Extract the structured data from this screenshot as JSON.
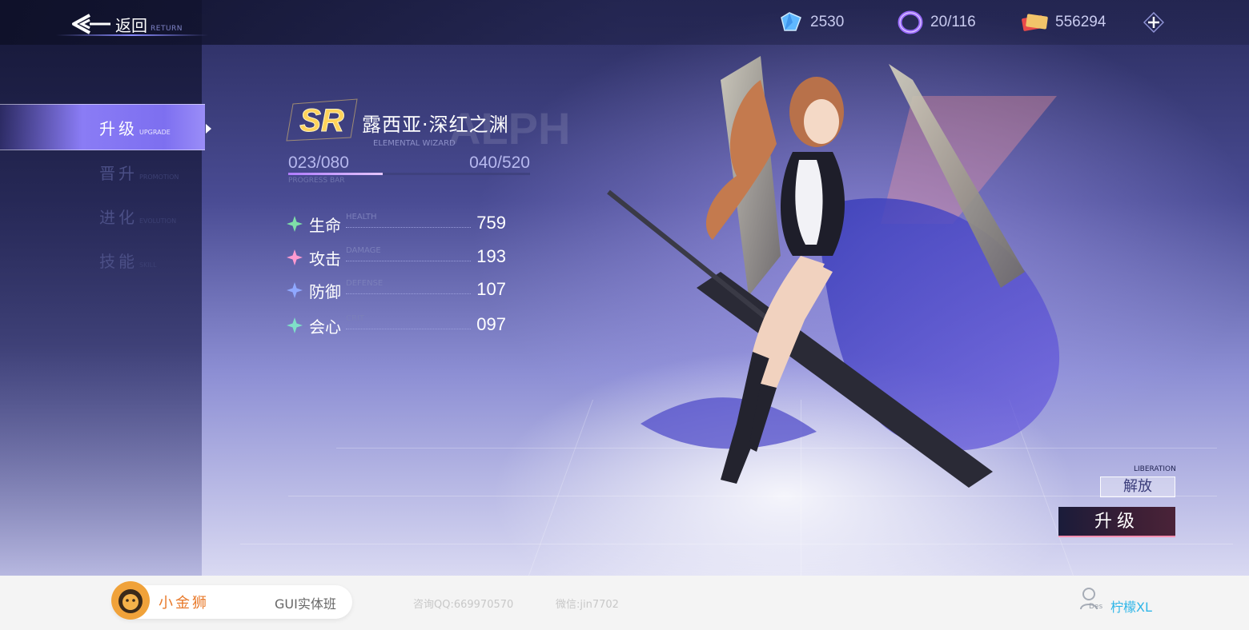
{
  "header": {
    "back_label": "返回",
    "back_sub": "RETURN",
    "currencies": [
      {
        "icon": "crystal-icon",
        "value": "2530"
      },
      {
        "icon": "ring-icon",
        "value": "20/116"
      },
      {
        "icon": "ticket-icon",
        "value": "556294"
      }
    ],
    "plus_icon": "plus-icon"
  },
  "nav": {
    "items": [
      {
        "label": "升级",
        "sub": "UPGRADE",
        "active": true
      },
      {
        "label": "晋升",
        "sub": "PROMOTION",
        "active": false
      },
      {
        "label": "进化",
        "sub": "EVOLUTION",
        "active": false
      },
      {
        "label": "技能",
        "sub": "SKILL",
        "active": false
      }
    ]
  },
  "character": {
    "rarity": "SR",
    "name": "露西亚·深红之渊",
    "class": "ELEMENTAL WIZARD",
    "bg_word": "ALPH",
    "level_current": "023/080",
    "exp": "040/520",
    "progress_caption": "PROGRESS BAR",
    "progress_fraction": 0.39
  },
  "stats": [
    {
      "name": "生命",
      "en": "HEALTH",
      "value": "759",
      "color": "#7fe0a8"
    },
    {
      "name": "攻击",
      "en": "DAMAGE",
      "value": "193",
      "color": "#ff9ad0"
    },
    {
      "name": "防御",
      "en": "DEFENSE",
      "value": "107",
      "color": "#8fa8ff"
    },
    {
      "name": "会心",
      "en": "CRIT",
      "value": "097",
      "color": "#7fe0c8"
    }
  ],
  "actions": {
    "liberation_caption": "LIBERATION",
    "liberation_label": "解放",
    "upgrade_label": "升级"
  },
  "footer": {
    "brand_name": "小金狮",
    "course": "GUI实体班",
    "qq": "咨询QQ:669970570",
    "wechat": "微信:jin7702",
    "user_sub": "Des",
    "user_name": "柠檬XL"
  },
  "colors": {
    "accent": "#8a7cf5",
    "upgrade_border": "#ff8fb0",
    "brand": "#e8792a",
    "user": "#2fb6e8"
  }
}
